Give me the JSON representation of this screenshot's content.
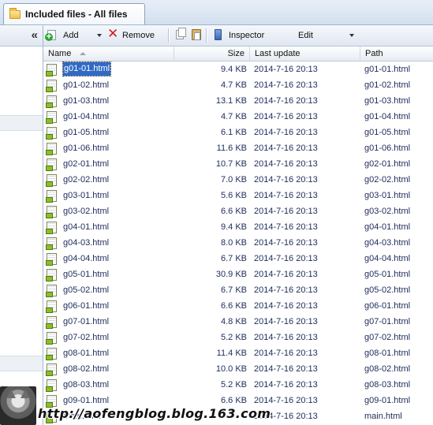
{
  "tab": {
    "title": "Included files - All files",
    "icon": "folder-icon"
  },
  "left_pane": {
    "collapse_label": "«"
  },
  "toolbar": {
    "add_label": "Add",
    "remove_label": "Remove",
    "inspector_label": "Inspector",
    "edit_label": "Edit"
  },
  "columns": {
    "name": "Name",
    "size": "Size",
    "last_update": "Last update",
    "path": "Path"
  },
  "files": [
    {
      "name": "g01-01.html",
      "size": "9.4 KB",
      "date": "2014-7-16 20:13",
      "path": "g01-01.html"
    },
    {
      "name": "g01-02.html",
      "size": "4.7 KB",
      "date": "2014-7-16 20:13",
      "path": "g01-02.html"
    },
    {
      "name": "g01-03.html",
      "size": "13.1 KB",
      "date": "2014-7-16 20:13",
      "path": "g01-03.html"
    },
    {
      "name": "g01-04.html",
      "size": "4.7 KB",
      "date": "2014-7-16 20:13",
      "path": "g01-04.html"
    },
    {
      "name": "g01-05.html",
      "size": "6.1 KB",
      "date": "2014-7-16 20:13",
      "path": "g01-05.html"
    },
    {
      "name": "g01-06.html",
      "size": "11.6 KB",
      "date": "2014-7-16 20:13",
      "path": "g01-06.html"
    },
    {
      "name": "g02-01.html",
      "size": "10.7 KB",
      "date": "2014-7-16 20:13",
      "path": "g02-01.html"
    },
    {
      "name": "g02-02.html",
      "size": "7.0 KB",
      "date": "2014-7-16 20:13",
      "path": "g02-02.html"
    },
    {
      "name": "g03-01.html",
      "size": "5.6 KB",
      "date": "2014-7-16 20:13",
      "path": "g03-01.html"
    },
    {
      "name": "g03-02.html",
      "size": "6.6 KB",
      "date": "2014-7-16 20:13",
      "path": "g03-02.html"
    },
    {
      "name": "g04-01.html",
      "size": "9.4 KB",
      "date": "2014-7-16 20:13",
      "path": "g04-01.html"
    },
    {
      "name": "g04-03.html",
      "size": "8.0 KB",
      "date": "2014-7-16 20:13",
      "path": "g04-03.html"
    },
    {
      "name": "g04-04.html",
      "size": "6.7 KB",
      "date": "2014-7-16 20:13",
      "path": "g04-04.html"
    },
    {
      "name": "g05-01.html",
      "size": "30.9 KB",
      "date": "2014-7-16 20:13",
      "path": "g05-01.html"
    },
    {
      "name": "g05-02.html",
      "size": "6.7 KB",
      "date": "2014-7-16 20:13",
      "path": "g05-02.html"
    },
    {
      "name": "g06-01.html",
      "size": "6.6 KB",
      "date": "2014-7-16 20:13",
      "path": "g06-01.html"
    },
    {
      "name": "g07-01.html",
      "size": "4.8 KB",
      "date": "2014-7-16 20:13",
      "path": "g07-01.html"
    },
    {
      "name": "g07-02.html",
      "size": "5.2 KB",
      "date": "2014-7-16 20:13",
      "path": "g07-02.html"
    },
    {
      "name": "g08-01.html",
      "size": "11.4 KB",
      "date": "2014-7-16 20:13",
      "path": "g08-01.html"
    },
    {
      "name": "g08-02.html",
      "size": "10.0 KB",
      "date": "2014-7-16 20:13",
      "path": "g08-02.html"
    },
    {
      "name": "g08-03.html",
      "size": "5.2 KB",
      "date": "2014-7-16 20:13",
      "path": "g08-03.html"
    },
    {
      "name": "g09-01.html",
      "size": "6.6 KB",
      "date": "2014-7-16 20:13",
      "path": "g09-01.html"
    },
    {
      "name": "main.html",
      "size": "",
      "date": "2014-7-16 20:13",
      "path": "main.html"
    }
  ],
  "selected_index": 0,
  "watermark": "http://aofengblog.blog.163.com"
}
